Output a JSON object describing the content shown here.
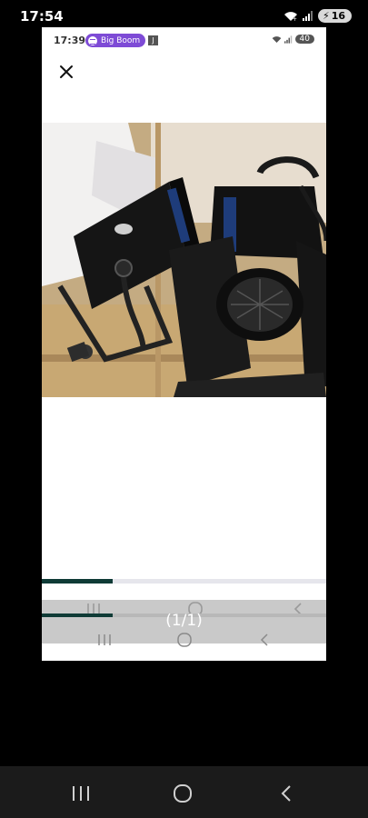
{
  "status_bar": {
    "time": "17:54",
    "battery": "16"
  },
  "screenshot": {
    "status_bar": {
      "time": "17:39",
      "spotify_label": "Big Boom",
      "note_icon": "J",
      "battery": "40"
    },
    "close_icon": "close-icon",
    "photo": {
      "subject": "two-stage-spotlights-with-barn-doors"
    },
    "progress": {
      "fraction": 0.25
    },
    "page_indicator": "(1/1)"
  },
  "nav_icons": [
    "recent-apps-icon",
    "home-icon",
    "back-icon"
  ],
  "colors": {
    "spotify": "#7e4bd6",
    "progress": "#0f3b36"
  }
}
